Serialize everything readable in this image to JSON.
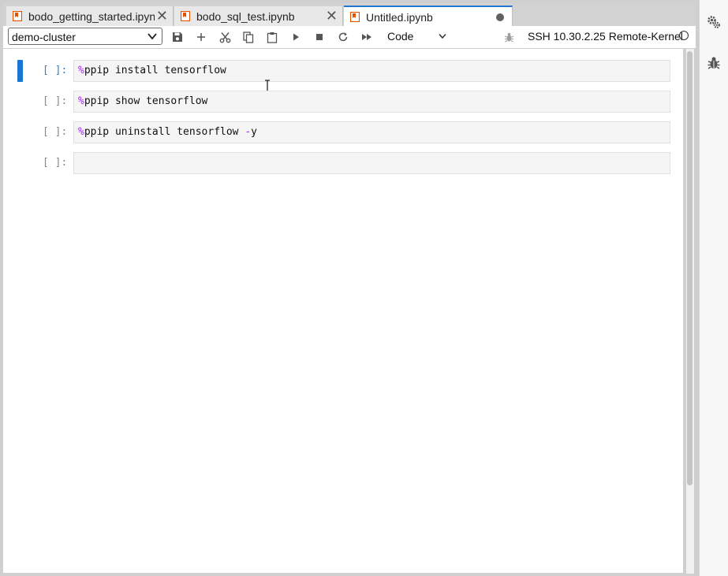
{
  "tabs": [
    {
      "label": "bodo_getting_started.ipynb",
      "active": false,
      "closable": true
    },
    {
      "label": "bodo_sql_test.ipynb",
      "active": false,
      "closable": true
    },
    {
      "label": "Untitled.ipynb",
      "active": true,
      "dirty": true
    }
  ],
  "toolbar": {
    "cluster_select": "demo-cluster",
    "cell_type": "Code",
    "kernel_status": "SSH 10.30.2.25 Remote-Kernel"
  },
  "cells": [
    {
      "prompt": "[ ]:",
      "magic": "%",
      "code": "ppip install tensorflow",
      "active": true
    },
    {
      "prompt": "[ ]:",
      "magic": "%",
      "code": "ppip show tensorflow",
      "active": false
    },
    {
      "prompt": "[ ]:",
      "magic": "%",
      "code": "ppip uninstall tensorflow ",
      "flag": "-",
      "flag_rest": "y",
      "active": false
    },
    {
      "prompt": "[ ]:",
      "magic": "",
      "code": "",
      "active": false
    }
  ],
  "colors": {
    "accent": "#1976d2",
    "tab_icon": "#e65100",
    "magic": "#aa22ff"
  },
  "icons": {
    "tab": "notebook-icon",
    "settings": "gear-icon",
    "debugger": "bug-icon"
  }
}
